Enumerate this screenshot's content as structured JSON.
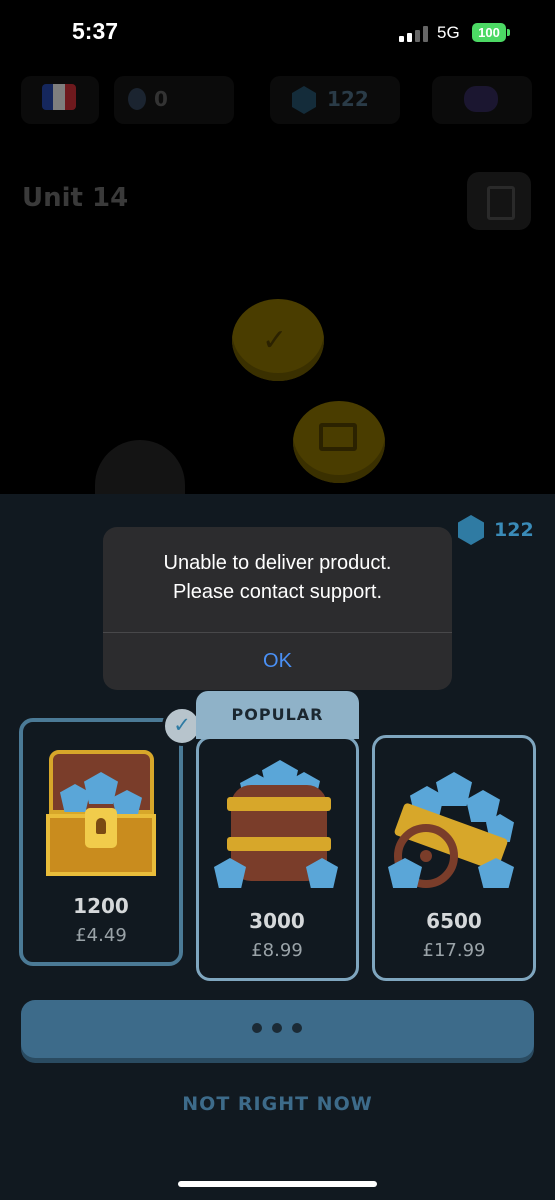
{
  "status_bar": {
    "time": "5:37",
    "network": "5G",
    "battery": "100"
  },
  "top_bar": {
    "flag": "France",
    "streak": "0",
    "gems": "122"
  },
  "unit": {
    "title": "Unit 14"
  },
  "shop": {
    "gem_balance": "122",
    "packages": [
      {
        "amount": "1200",
        "price": "£4.49",
        "selected": true
      },
      {
        "amount": "3000",
        "price": "£8.99",
        "badge": "POPULAR"
      },
      {
        "amount": "6500",
        "price": "£17.99"
      }
    ],
    "dismiss_label": "NOT RIGHT NOW"
  },
  "alert": {
    "line1": "Unable to deliver product.",
    "line2": "Please contact support.",
    "ok_label": "OK"
  },
  "colors": {
    "accent": "#3d6b8a",
    "gem": "#2f7ba3",
    "alert_button": "#4a90f5",
    "battery": "#4cd964"
  }
}
